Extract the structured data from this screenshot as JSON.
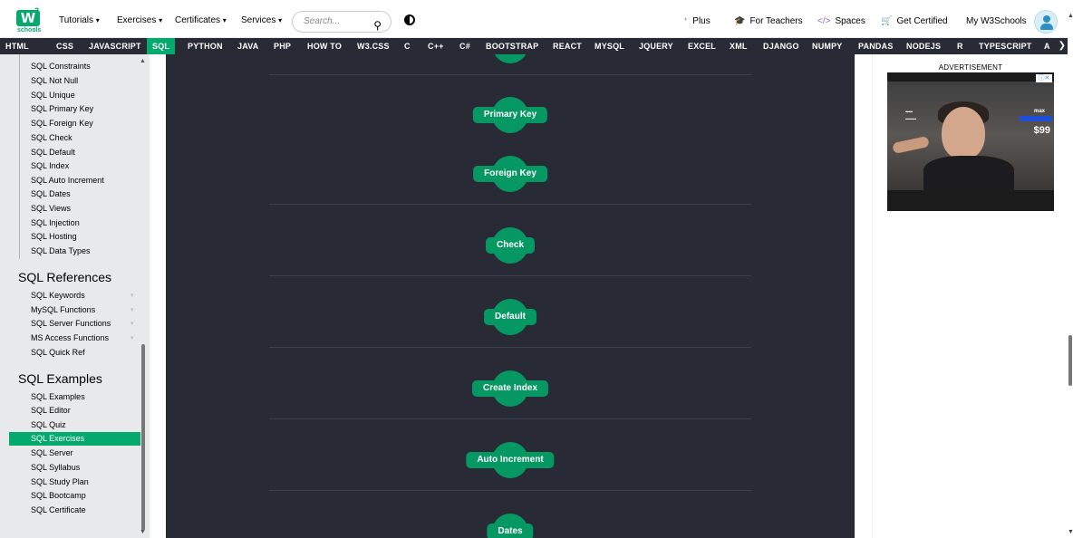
{
  "topbar": {
    "logo": {
      "mark": "W",
      "sup": "3",
      "text": "schools"
    },
    "nav": [
      {
        "label": "Tutorials",
        "caret": "▾"
      },
      {
        "label": "Exercises",
        "caret": "▾"
      },
      {
        "label": "Certificates",
        "caret": "▾"
      },
      {
        "label": "Services",
        "caret": "▾"
      }
    ],
    "search": {
      "placeholder": "Search...",
      "icon": "search-icon"
    },
    "right_links": [
      {
        "icon": "plus-icon",
        "glyph": "⁺",
        "label": "Plus"
      },
      {
        "icon": "teacher-icon",
        "glyph": "🎓",
        "label": "For Teachers"
      },
      {
        "icon": "spaces-icon",
        "glyph": "</>",
        "label": "Spaces"
      },
      {
        "icon": "cart-icon",
        "glyph": "🛒",
        "label": "Get Certified"
      },
      {
        "icon": "",
        "glyph": "",
        "label": "My W3Schools"
      }
    ]
  },
  "langbar": {
    "items": [
      "HTML",
      "CSS",
      "JAVASCRIPT",
      "SQL",
      "PYTHON",
      "JAVA",
      "PHP",
      "HOW TO",
      "W3.CSS",
      "C",
      "C++",
      "C#",
      "BOOTSTRAP",
      "REACT",
      "MYSQL",
      "JQUERY",
      "EXCEL",
      "XML",
      "DJANGO",
      "NUMPY",
      "PANDAS",
      "NODEJS",
      "R",
      "TYPESCRIPT",
      "A"
    ],
    "active": "SQL",
    "arrow": "❯"
  },
  "sidebar": {
    "group1": [
      "SQL Constraints",
      "SQL Not Null",
      "SQL Unique",
      "SQL Primary Key",
      "SQL Foreign Key",
      "SQL Check",
      "SQL Default",
      "SQL Index",
      "SQL Auto Increment",
      "SQL Dates",
      "SQL Views",
      "SQL Injection",
      "SQL Hosting",
      "SQL Data Types"
    ],
    "heading2": "SQL References",
    "group2": [
      "SQL Keywords",
      "MySQL Functions",
      "SQL Server Functions",
      "MS Access Functions",
      "SQL Quick Ref"
    ],
    "heading3": "SQL Examples",
    "group3": [
      "SQL Examples",
      "SQL Editor",
      "SQL Quiz",
      "SQL Exercises",
      "SQL Server",
      "SQL Syllabus",
      "SQL Study Plan",
      "SQL Bootcamp",
      "SQL Certificate"
    ],
    "active": "SQL Exercises"
  },
  "main": {
    "pills": [
      "Primary Key",
      "Foreign Key",
      "Check",
      "Default",
      "Create Index",
      "Auto Increment",
      "Dates"
    ]
  },
  "ad": {
    "label": "ADVERTISEMENT",
    "brand": "max",
    "price": "$99"
  },
  "colors": {
    "accent": "#04AA6D",
    "dark": "#282A35",
    "sidebar": "#E7E9EB",
    "pill": "#059862"
  }
}
